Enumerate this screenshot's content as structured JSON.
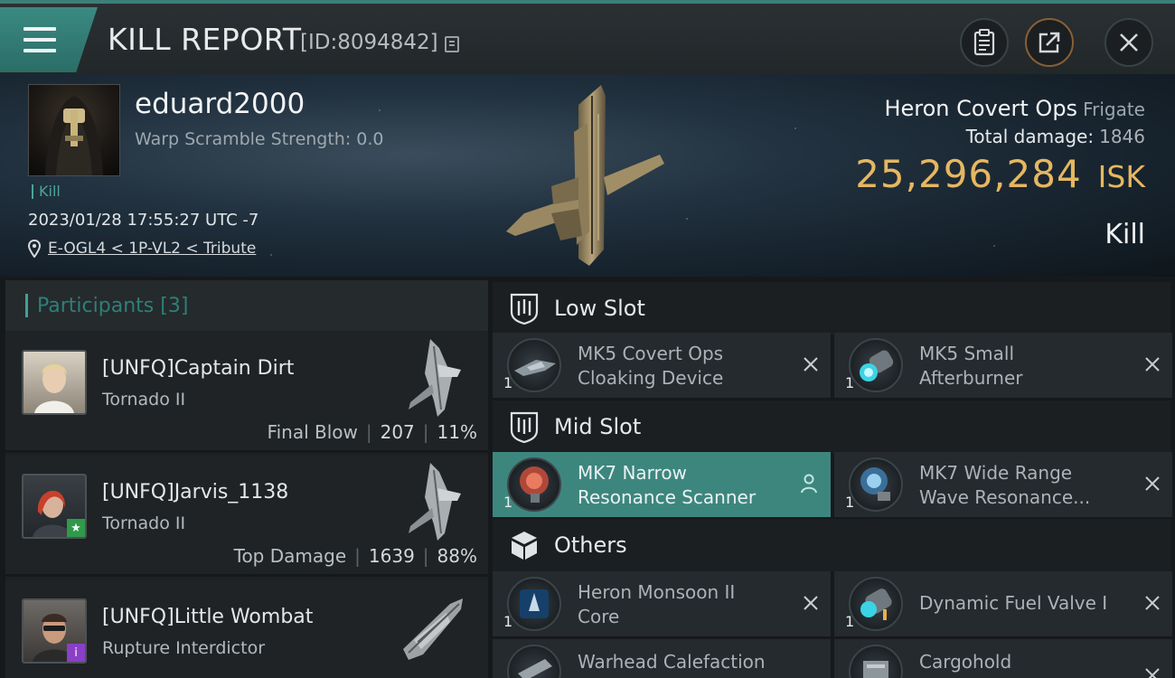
{
  "header": {
    "title": "KILL REPORT",
    "report_id": "[ID:8094842]"
  },
  "victim": {
    "pilot_name": "eduard2000",
    "warp_scramble": "Warp Scramble Strength: 0.0",
    "kill_tag": "Kill",
    "timestamp": "2023/01/28 17:55:27 UTC -7",
    "location": "E-OGL4 < 1P-VL2 < Tribute",
    "ship_name": "Heron Covert Ops",
    "ship_class": "Frigate",
    "total_damage_label": "Total damage:",
    "total_damage": "1846",
    "isk_value": "25,296,284",
    "isk_unit": "ISK",
    "result": "Kill"
  },
  "participants": {
    "label": "Participants",
    "count": "[3]",
    "rows": [
      {
        "name": "[UNFQ]Captain Dirt",
        "ship": "Tornado II",
        "role": "Final Blow",
        "damage": "207",
        "percent": "11%"
      },
      {
        "name": "[UNFQ]Jarvis_1138",
        "ship": "Tornado II",
        "role": "Top Damage",
        "damage": "1639",
        "percent": "88%"
      },
      {
        "name": "[UNFQ]Little Wombat",
        "ship": "Rupture Interdictor"
      }
    ]
  },
  "slots": {
    "low": {
      "title": "Low Slot",
      "modules": [
        {
          "qty": "1",
          "line1": "MK5 Covert Ops",
          "line2": "Cloaking Device"
        },
        {
          "qty": "1",
          "line1": "MK5 Small",
          "line2": "Afterburner"
        }
      ]
    },
    "mid": {
      "title": "Mid Slot",
      "modules": [
        {
          "qty": "1",
          "line1": "MK7 Narrow",
          "line2": "Resonance Scanner"
        },
        {
          "qty": "1",
          "line1": "MK7 Wide Range",
          "line2": "Wave Resonance..."
        }
      ]
    },
    "others": {
      "title": "Others",
      "modules": [
        {
          "qty": "1",
          "line1": "Heron Monsoon II",
          "line2": "Core"
        },
        {
          "qty": "1",
          "line1": "Dynamic Fuel Valve I"
        },
        {
          "qty": "",
          "line1": "Warhead Calefaction"
        },
        {
          "qty": "",
          "line1": "Cargohold"
        }
      ]
    }
  },
  "colors": {
    "accent": "#3d867e",
    "isk": "#e6b761",
    "kill_tag": "#4aa597"
  }
}
